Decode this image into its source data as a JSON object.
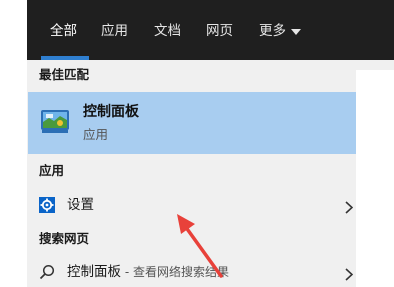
{
  "tabs": [
    {
      "label": "全部",
      "active": true
    },
    {
      "label": "应用",
      "active": false
    },
    {
      "label": "文档",
      "active": false
    },
    {
      "label": "网页",
      "active": false
    },
    {
      "label": "更多",
      "active": false
    }
  ],
  "sections": {
    "best_match": "最佳匹配",
    "apps": "应用",
    "web": "搜索网页"
  },
  "best_match": {
    "title": "控制面板",
    "subtitle": "应用",
    "icon": "control-panel-icon"
  },
  "app_results": [
    {
      "label": "设置",
      "icon": "settings-gear-icon"
    }
  ],
  "web_results": [
    {
      "query": "控制面板",
      "suffix": " - 查看网络搜索结果",
      "icon": "search-icon"
    }
  ],
  "colors": {
    "tabbar_bg": "#1f1f1f",
    "accent": "#2f7fd0",
    "selection": "#a8cdf0",
    "panel_bg": "#f0f0f0",
    "annotation_arrow": "#e8413a"
  }
}
